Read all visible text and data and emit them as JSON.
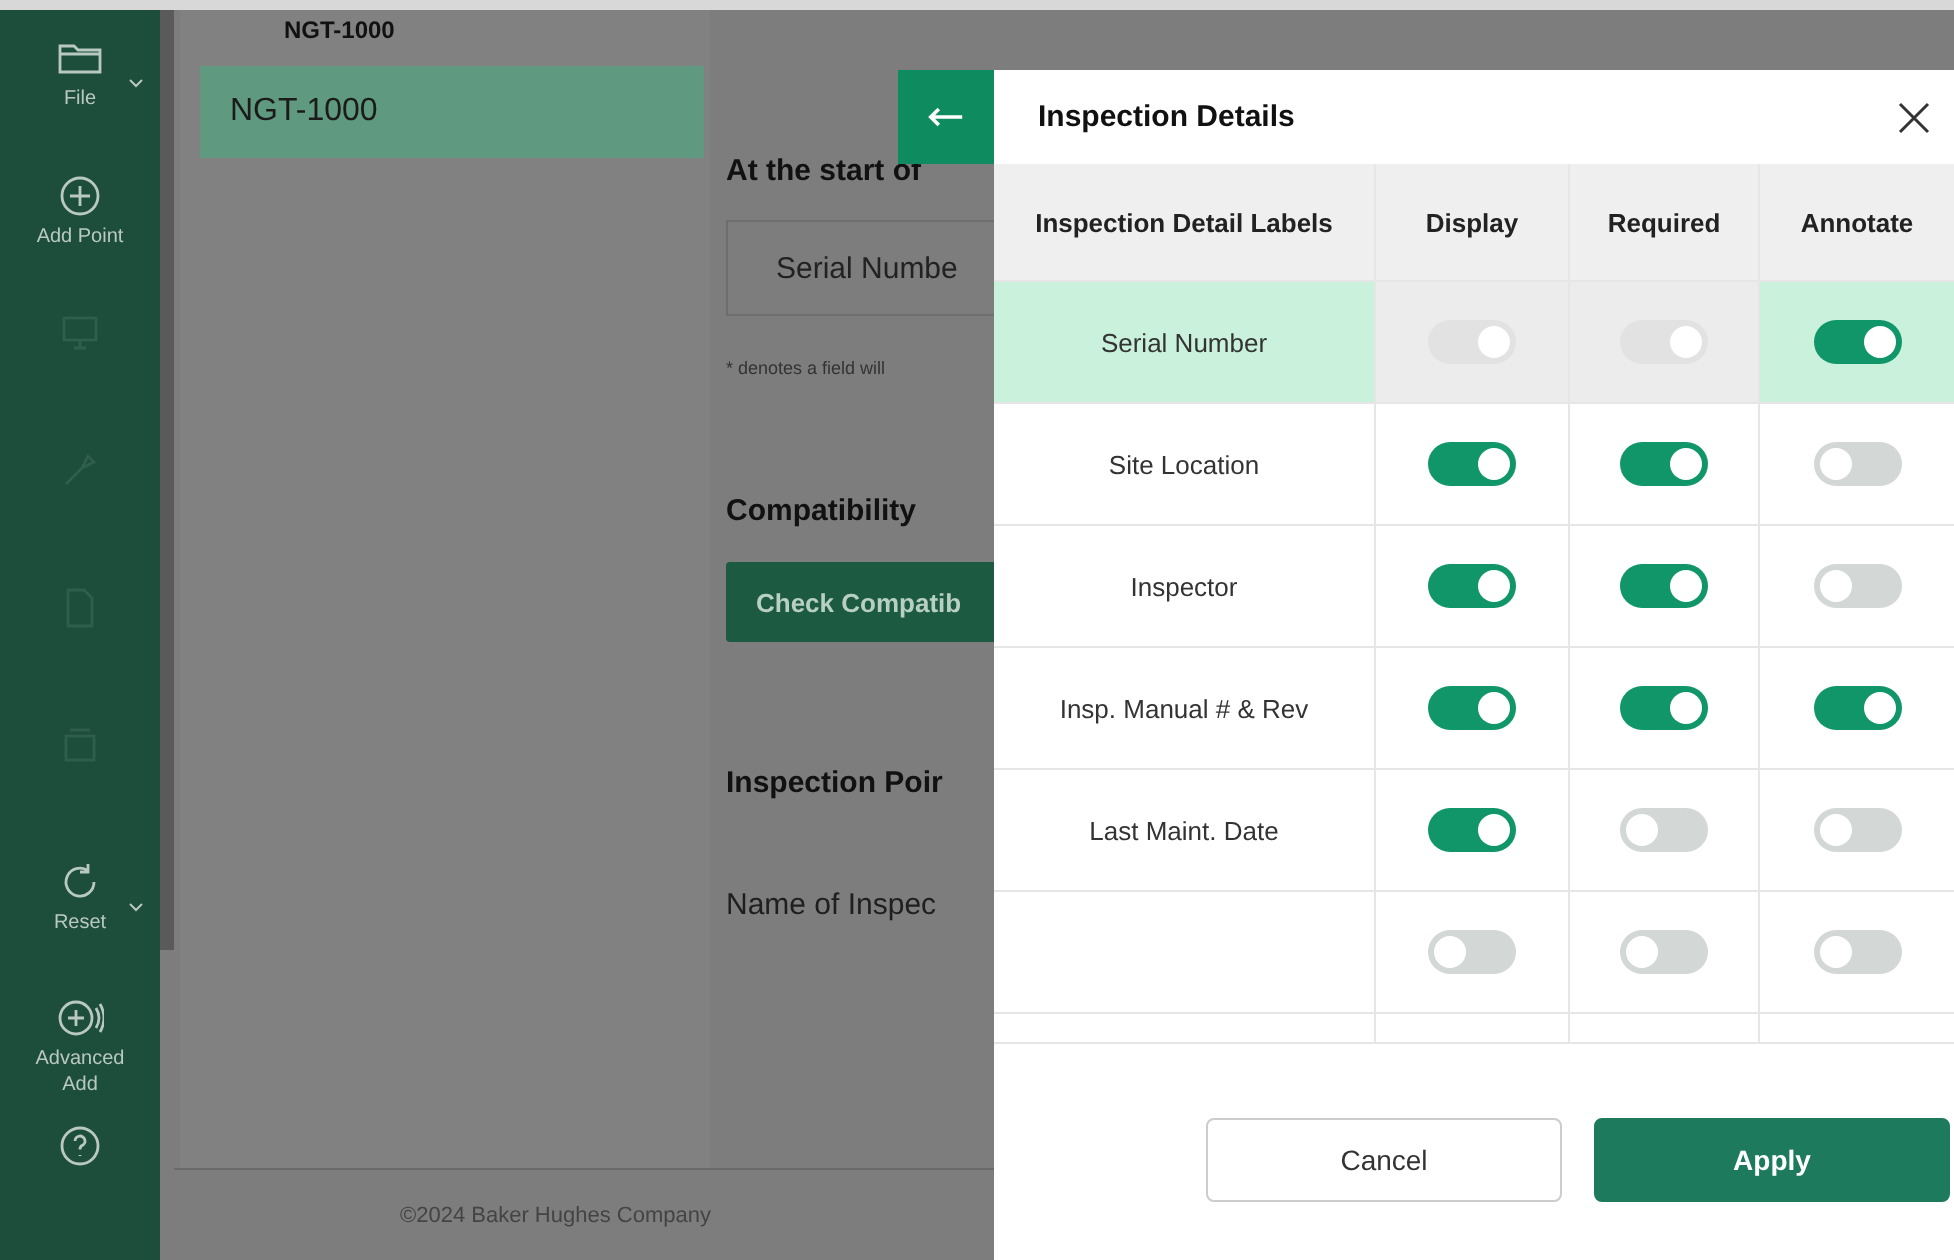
{
  "sidebar": {
    "items": [
      {
        "label": "File",
        "disabled": false,
        "dropdown": true
      },
      {
        "label": "Add Point",
        "disabled": false,
        "dropdown": false
      },
      {
        "disabled": true,
        "dropdown": false
      },
      {
        "disabled": true,
        "dropdown": false
      },
      {
        "disabled": true,
        "dropdown": false
      },
      {
        "disabled": true,
        "dropdown": false
      },
      {
        "label": "Reset",
        "disabled": false,
        "dropdown": true
      },
      {
        "label": "Advanced Add",
        "disabled": false,
        "dropdown": false
      },
      {
        "disabled": false,
        "dropdown": false
      }
    ]
  },
  "list_panel": {
    "header": "NGT-1000",
    "items": [
      {
        "label": "NGT-1000",
        "selected": true
      }
    ]
  },
  "content": {
    "start_heading": "At the start of",
    "field_value": "Serial Numbe",
    "note": "* denotes a field will",
    "compat_heading": "Compatibility",
    "compat_button": "Check Compatib",
    "points_heading": "Inspection Poir",
    "name_label": "Name of Inspec"
  },
  "footer": "©2024 Baker Hughes Company",
  "dialog": {
    "title": "Inspection Details",
    "columns": [
      "Inspection Detail Labels",
      "Display",
      "Required",
      "Annotate"
    ],
    "rows": [
      {
        "label": "Serial Number",
        "selected": true,
        "toggles": [
          {
            "on": true,
            "disabled": true
          },
          {
            "on": true,
            "disabled": true
          },
          {
            "on": true,
            "disabled": false
          }
        ]
      },
      {
        "label": "Site Location",
        "selected": false,
        "toggles": [
          {
            "on": true,
            "disabled": false
          },
          {
            "on": true,
            "disabled": false
          },
          {
            "on": false,
            "disabled": false
          }
        ]
      },
      {
        "label": "Inspector",
        "selected": false,
        "toggles": [
          {
            "on": true,
            "disabled": false
          },
          {
            "on": true,
            "disabled": false
          },
          {
            "on": false,
            "disabled": false
          }
        ]
      },
      {
        "label": "Insp. Manual # & Rev",
        "selected": false,
        "toggles": [
          {
            "on": true,
            "disabled": false
          },
          {
            "on": true,
            "disabled": false
          },
          {
            "on": true,
            "disabled": false
          }
        ]
      },
      {
        "label": "Last Maint. Date",
        "selected": false,
        "toggles": [
          {
            "on": true,
            "disabled": false
          },
          {
            "on": false,
            "disabled": false
          },
          {
            "on": false,
            "disabled": false
          }
        ]
      },
      {
        "selected": false,
        "toggles": [
          {
            "on": false,
            "disabled": false
          },
          {
            "on": false,
            "disabled": false
          },
          {
            "on": false,
            "disabled": false
          }
        ]
      }
    ],
    "buttons": [
      "Cancel",
      "Apply"
    ]
  }
}
